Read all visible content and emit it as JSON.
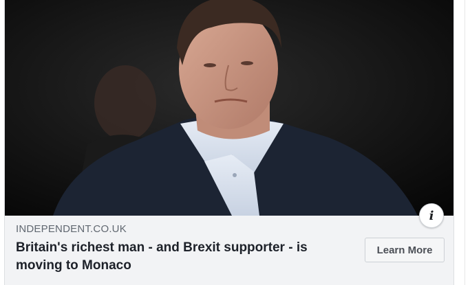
{
  "ad": {
    "domain": "INDEPENDENT.CO.UK",
    "headline": "Britain's richest man - and Brexit supporter - is moving to Monaco",
    "cta_label": "Learn More",
    "info_glyph": "i",
    "image_icon": "photo-of-man",
    "info_icon": "info-icon"
  },
  "colors": {
    "card_bg": "#f2f3f5",
    "domain_text": "#606770",
    "headline_text": "#1d2129",
    "cta_text": "#4b4f56"
  }
}
